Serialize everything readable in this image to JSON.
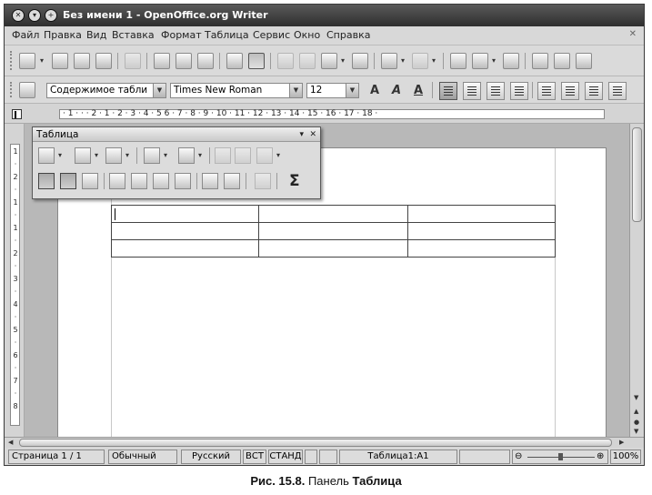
{
  "window": {
    "title": "Без имени 1 - OpenOffice.org Writer",
    "controls": [
      "close-icon",
      "minimize-icon",
      "maximize-icon"
    ]
  },
  "menubar": {
    "items": [
      "Файл",
      "Правка",
      "Вид",
      "Вставка",
      "Формат",
      "Таблица",
      "Сервис",
      "Окно",
      "Справка"
    ]
  },
  "toolbar_standard": {
    "icons": [
      "new-document-icon",
      "open-icon",
      "save-icon",
      "email-icon",
      "edit-file-icon",
      "export-pdf-icon",
      "print-icon",
      "print-preview-icon",
      "spellcheck-icon",
      "autospellcheck-icon",
      "cut-icon",
      "copy-icon",
      "paste-icon",
      "clone-format-icon",
      "undo-icon",
      "redo-icon",
      "hyperlink-icon",
      "table-icon",
      "show-draw-functions-icon",
      "navigator-icon",
      "gallery-icon",
      "datasources-icon"
    ]
  },
  "toolbar_format": {
    "paragraph_style": "Содержимое табли",
    "font_name": "Times New Roman",
    "font_size": "12",
    "icons": [
      "styles-icon",
      "bold-icon",
      "italic-icon",
      "underline-icon",
      "align-left-icon",
      "align-center-icon",
      "align-right-icon",
      "justify-icon",
      "numbering-icon",
      "bullets-icon",
      "decrease-indent-icon",
      "increase-indent-icon"
    ]
  },
  "ruler": {
    "horizontal": "· 1 · · · 2 · 1 · 2 · 3 · 4 · 5 6 · 7 · 8 · 9 · 10 · 11 · 12 · 13 · 14 · 15 · 16 · 17 · 18 ·",
    "vertical": [
      "1",
      "·",
      "2",
      "·",
      "1",
      "·",
      "1",
      "·",
      "2",
      "·",
      "3",
      "·",
      "4",
      "·",
      "5",
      "·",
      "6",
      "·",
      "7",
      "·",
      "8"
    ]
  },
  "table_panel": {
    "title": "Таблица",
    "row1_icons": [
      "table-icon",
      "borders-icon",
      "line-color-icon",
      "border-color-icon",
      "background-color-icon",
      "merge-cells-icon",
      "split-cells-icon",
      "optimize-icon"
    ],
    "row2_icons": [
      "align-top-icon",
      "align-center-vertical-icon",
      "align-bottom-icon",
      "insert-row-icon",
      "insert-column-icon",
      "delete-row-icon",
      "delete-column-icon",
      "autoformat-icon",
      "table-properties-icon",
      "sort-icon"
    ],
    "sum_symbol": "Σ"
  },
  "document": {
    "rows": 3,
    "cols": 3
  },
  "statusbar": {
    "page": "Страница 1 / 1",
    "style": "Обычный",
    "language": "Русский",
    "insert_mode": "ВСТ",
    "selection_mode": "СТАНД",
    "cell_ref": "Таблица1:A1",
    "zoom": "100%"
  },
  "caption": {
    "prefix": "Рис. 15.8.",
    "text": " Панель ",
    "bold": "Таблица"
  }
}
